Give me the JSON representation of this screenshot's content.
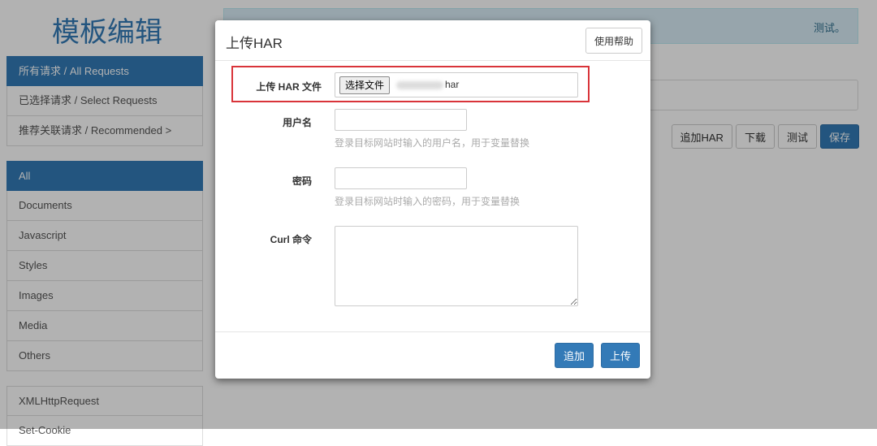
{
  "page": {
    "title": "模板编辑",
    "alert_text": "测试。"
  },
  "sidebar": {
    "request_groups": [
      "所有请求 / All Requests",
      "已选择请求 / Select Requests",
      "推荐关联请求 / Recommended >"
    ],
    "types": [
      "All",
      "Documents",
      "Javascript",
      "Styles",
      "Images",
      "Media",
      "Others"
    ],
    "extra": [
      "XMLHttpRequest",
      "Set-Cookie"
    ]
  },
  "toolbar": {
    "add_har": "追加HAR",
    "download": "下载",
    "test": "测试",
    "save": "保存"
  },
  "modal": {
    "title": "上传HAR",
    "help": "使用帮助",
    "file_label": "上传 HAR 文件",
    "choose_file": "选择文件",
    "file_name": "har",
    "username_label": "用户名",
    "username_value": "",
    "username_help": "登录目标网站时输入的用户名，用于变量替换",
    "password_label": "密码",
    "password_value": "",
    "password_help": "登录目标网站时输入的密码，用于变量替换",
    "curl_label": "Curl 命令",
    "curl_value": "",
    "add": "追加",
    "upload": "上传"
  }
}
